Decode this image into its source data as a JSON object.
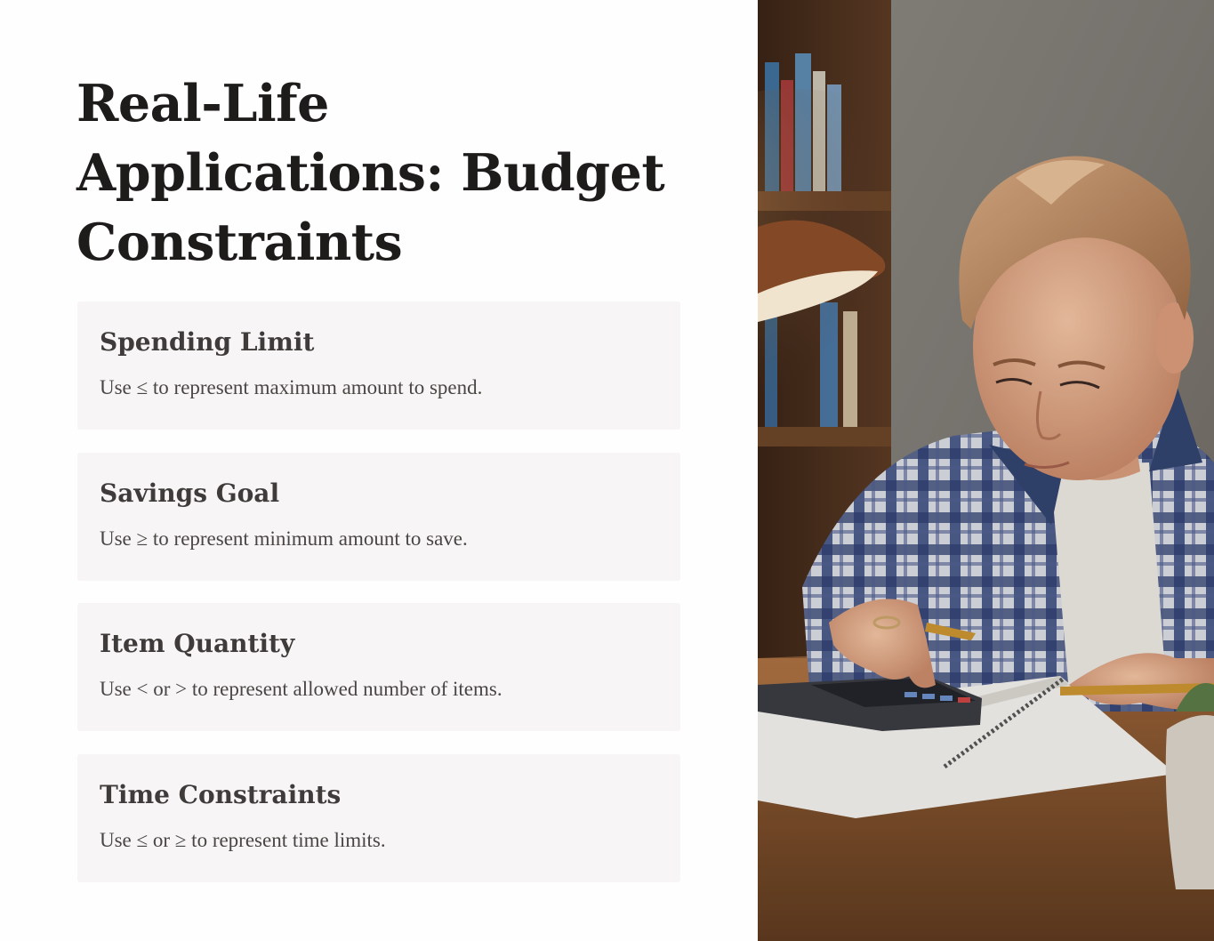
{
  "title": "Real-Life Applications: Budget Constraints",
  "cards": [
    {
      "heading": "Spending Limit",
      "text": "Use ≤ to represent maximum amount to spend."
    },
    {
      "heading": "Savings Goal",
      "text": "Use ≥ to represent minimum amount to save."
    },
    {
      "heading": "Item Quantity",
      "text": "Use < or > to represent allowed number of items."
    },
    {
      "heading": "Time Constraints",
      "text": "Use ≤ or ≥ to represent time limits."
    }
  ],
  "photo": {
    "subject": "student-with-calculator-illustration"
  },
  "colors": {
    "title": "#1e1b1b",
    "card_bg": "#f7f5f5",
    "card_heading": "#3f3b3b",
    "card_text": "#4a4545"
  }
}
